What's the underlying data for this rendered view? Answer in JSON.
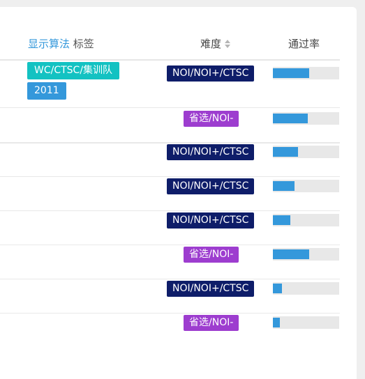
{
  "header": {
    "show_algo_link": "显示算法",
    "tags_label": "标签",
    "difficulty_label": "难度",
    "pass_rate_label": "通过率"
  },
  "colors": {
    "noi_ctsc": "#0e1d69",
    "shengxuan": "#9d3dcf",
    "tag_teal": "#13c2c2",
    "tag_blue": "#3498db",
    "bar_fill": "#3498db",
    "bar_bg": "#e8e8e8"
  },
  "rows": [
    {
      "tags": [
        "WC/CTSC/集训队",
        "2011"
      ],
      "difficulty": "NOI/NOI+/CTSC",
      "pass_rate": 0.55
    },
    {
      "tags": [],
      "difficulty": "省选/NOI-",
      "pass_rate": 0.53
    },
    {
      "tags": [],
      "difficulty": "NOI/NOI+/CTSC",
      "pass_rate": 0.38
    },
    {
      "tags": [],
      "difficulty": "NOI/NOI+/CTSC",
      "pass_rate": 0.33
    },
    {
      "tags": [],
      "difficulty": "NOI/NOI+/CTSC",
      "pass_rate": 0.26
    },
    {
      "tags": [],
      "difficulty": "省选/NOI-",
      "pass_rate": 0.55
    },
    {
      "tags": [],
      "difficulty": "NOI/NOI+/CTSC",
      "pass_rate": 0.14
    },
    {
      "tags": [],
      "difficulty": "省选/NOI-",
      "pass_rate": 0.11
    }
  ]
}
